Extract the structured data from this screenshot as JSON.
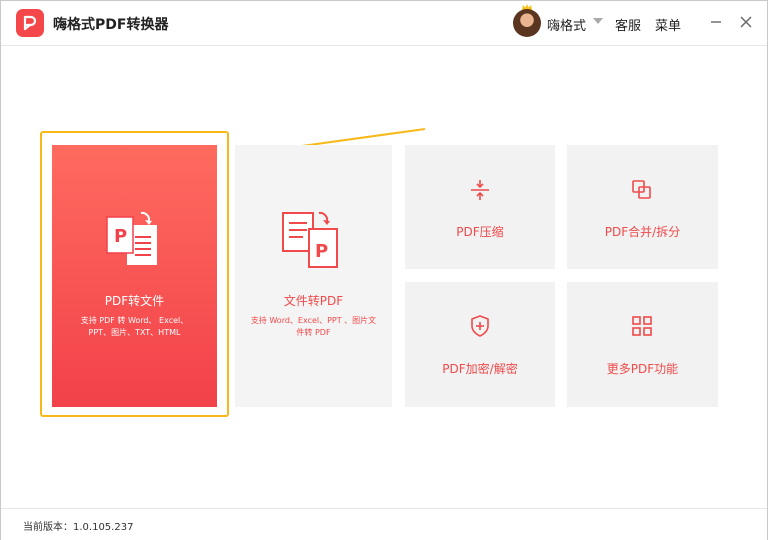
{
  "app": {
    "title": "嗨格式PDF转换器"
  },
  "header": {
    "username": "嗨格式",
    "service_label": "客服",
    "menu_label": "菜单"
  },
  "tiles": {
    "pdf_to_file": {
      "title": "PDF转文件",
      "desc_line1": "支持 PDF 转 Word、 Excel、",
      "desc_line2": "PPT、图片、TXT、HTML"
    },
    "file_to_pdf": {
      "title": "文件转PDF",
      "desc_line1": "支持 Word、Excel、PPT 、图片文",
      "desc_line2": "件转 PDF"
    },
    "pdf_compress": {
      "title": "PDF压缩"
    },
    "pdf_merge_split": {
      "title": "PDF合并/拆分"
    },
    "pdf_encrypt": {
      "title": "PDF加密/解密"
    },
    "more_features": {
      "title": "更多PDF功能"
    }
  },
  "footer": {
    "version": "当前版本：1.0.105.237"
  },
  "colors": {
    "accent": "#f04a4a",
    "highlight": "#f7b91a",
    "tile_bg": "#f2f2f2"
  }
}
